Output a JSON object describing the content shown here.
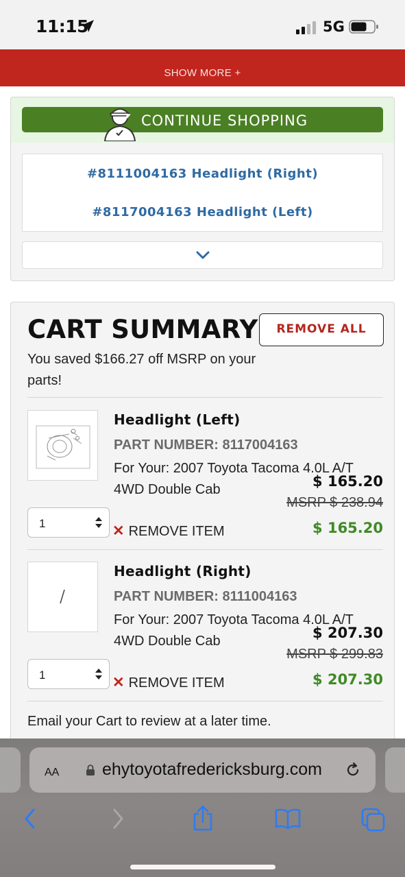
{
  "status_bar": {
    "time": "11:15",
    "network": "5G"
  },
  "banner": {
    "show_more": "SHOW MORE +"
  },
  "continue": {
    "label": "CONTINUE SHOPPING"
  },
  "part_links": [
    "#8111004163 Headlight (Right)",
    "#8117004163 Headlight (Left)"
  ],
  "cart": {
    "title": "CART SUMMARY",
    "remove_all": "REMOVE ALL",
    "saved_text": "You saved $166.27 off MSRP on your parts!",
    "items": [
      {
        "name": "Headlight (Left)",
        "part_number": "PART NUMBER: 8117004163",
        "for_your": "For Your: 2007 Toyota Tacoma 4.0L A/T 4WD Double Cab",
        "price": "$ 165.20",
        "msrp": "MSRP $ 238.94",
        "quantity": "1",
        "remove_label": "REMOVE ITEM",
        "subtotal": "$ 165.20"
      },
      {
        "name": "Headlight (Right)",
        "part_number": "PART NUMBER: 8111004163",
        "for_your": "For Your: 2007 Toyota Tacoma 4.0L A/T 4WD Double Cab",
        "price": "$ 207.30",
        "msrp": "MSRP $ 299.83",
        "quantity": "1",
        "remove_label": "REMOVE ITEM",
        "subtotal": "$ 207.30"
      }
    ],
    "email_text": "Email your Cart to review at a later time."
  },
  "browser": {
    "aa_label": "AA",
    "url": "ehytoyotafredericksburg.com"
  },
  "icons": {
    "location": "location-arrow-icon",
    "signal": "cellular-signal-icon",
    "battery": "battery-icon",
    "mechanic": "mechanic-icon",
    "check": "check-icon",
    "chevron": "chevron-down-icon",
    "qty_stepper": "stepper-arrows-icon",
    "remove": "close-icon",
    "lock": "lock-icon",
    "reload": "reload-icon",
    "back": "back-icon",
    "forward": "forward-icon",
    "share": "share-icon",
    "bookmarks": "book-icon",
    "tabs": "tabs-icon"
  },
  "colors": {
    "banner_red": "#c0261e",
    "continue_green": "#4a7f24",
    "link_blue": "#2f6aa3",
    "price_green": "#3f8a26",
    "remove_red": "#b3261e"
  }
}
